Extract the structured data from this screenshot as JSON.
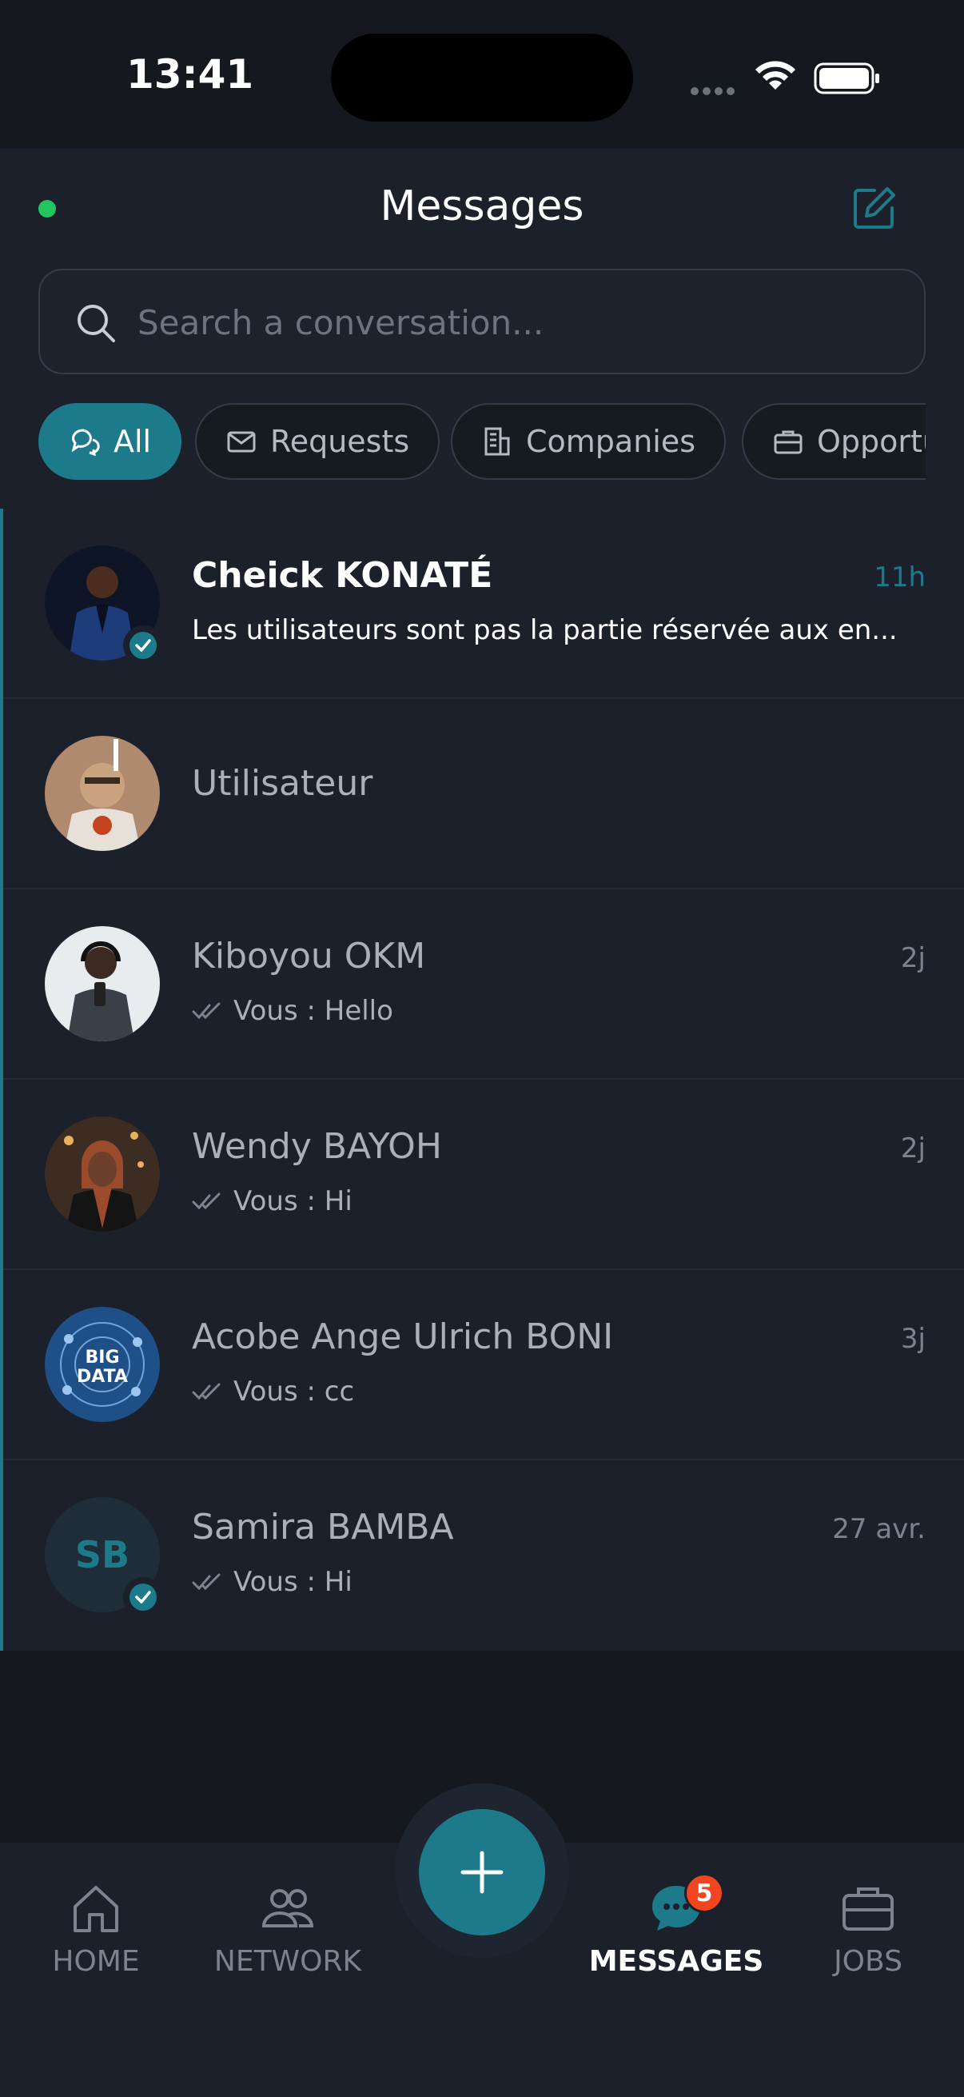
{
  "status_bar": {
    "time": "13:41"
  },
  "header": {
    "title": "Messages"
  },
  "search": {
    "placeholder": "Search a conversation..."
  },
  "filters": [
    {
      "label": "All",
      "icon": "chat-bubbles-icon",
      "active": true
    },
    {
      "label": "Requests",
      "icon": "envelope-icon",
      "active": false
    },
    {
      "label": "Companies",
      "icon": "building-icon",
      "active": false
    },
    {
      "label": "Opportu",
      "icon": "briefcase-icon",
      "active": false
    }
  ],
  "conversations": [
    {
      "name": "Cheick KONATÉ",
      "time": "11h",
      "preview": "Les utilisateurs sont pas la partie réservée aux en...",
      "unread": true,
      "verified": true
    },
    {
      "name": "Utilisateur",
      "time": "",
      "preview": "",
      "unread": false,
      "verified": false
    },
    {
      "name": "Kiboyou OKM",
      "time": "2j",
      "preview": "Vous : Hello",
      "unread": false,
      "verified": false
    },
    {
      "name": "Wendy BAYOH",
      "time": "2j",
      "preview": "Vous : Hi",
      "unread": false,
      "verified": false
    },
    {
      "name": "Acobe Ange Ulrich BONI",
      "time": "3j",
      "preview": "Vous : cc",
      "unread": false,
      "verified": false,
      "avatar_text": [
        "BIG",
        "DATA"
      ]
    },
    {
      "name": "Samira BAMBA",
      "time": "27 avr.",
      "preview": "Vous : Hi",
      "unread": false,
      "verified": true,
      "initials": "SB"
    }
  ],
  "bottom_nav": {
    "home": "HOME",
    "network": "NETWORK",
    "messages": "MESSAGES",
    "jobs": "JOBS",
    "messages_badge": "5"
  },
  "colors": {
    "accent": "#1d7a8a",
    "online": "#22c55e",
    "badge": "#f0451e",
    "background": "#1b202a"
  }
}
